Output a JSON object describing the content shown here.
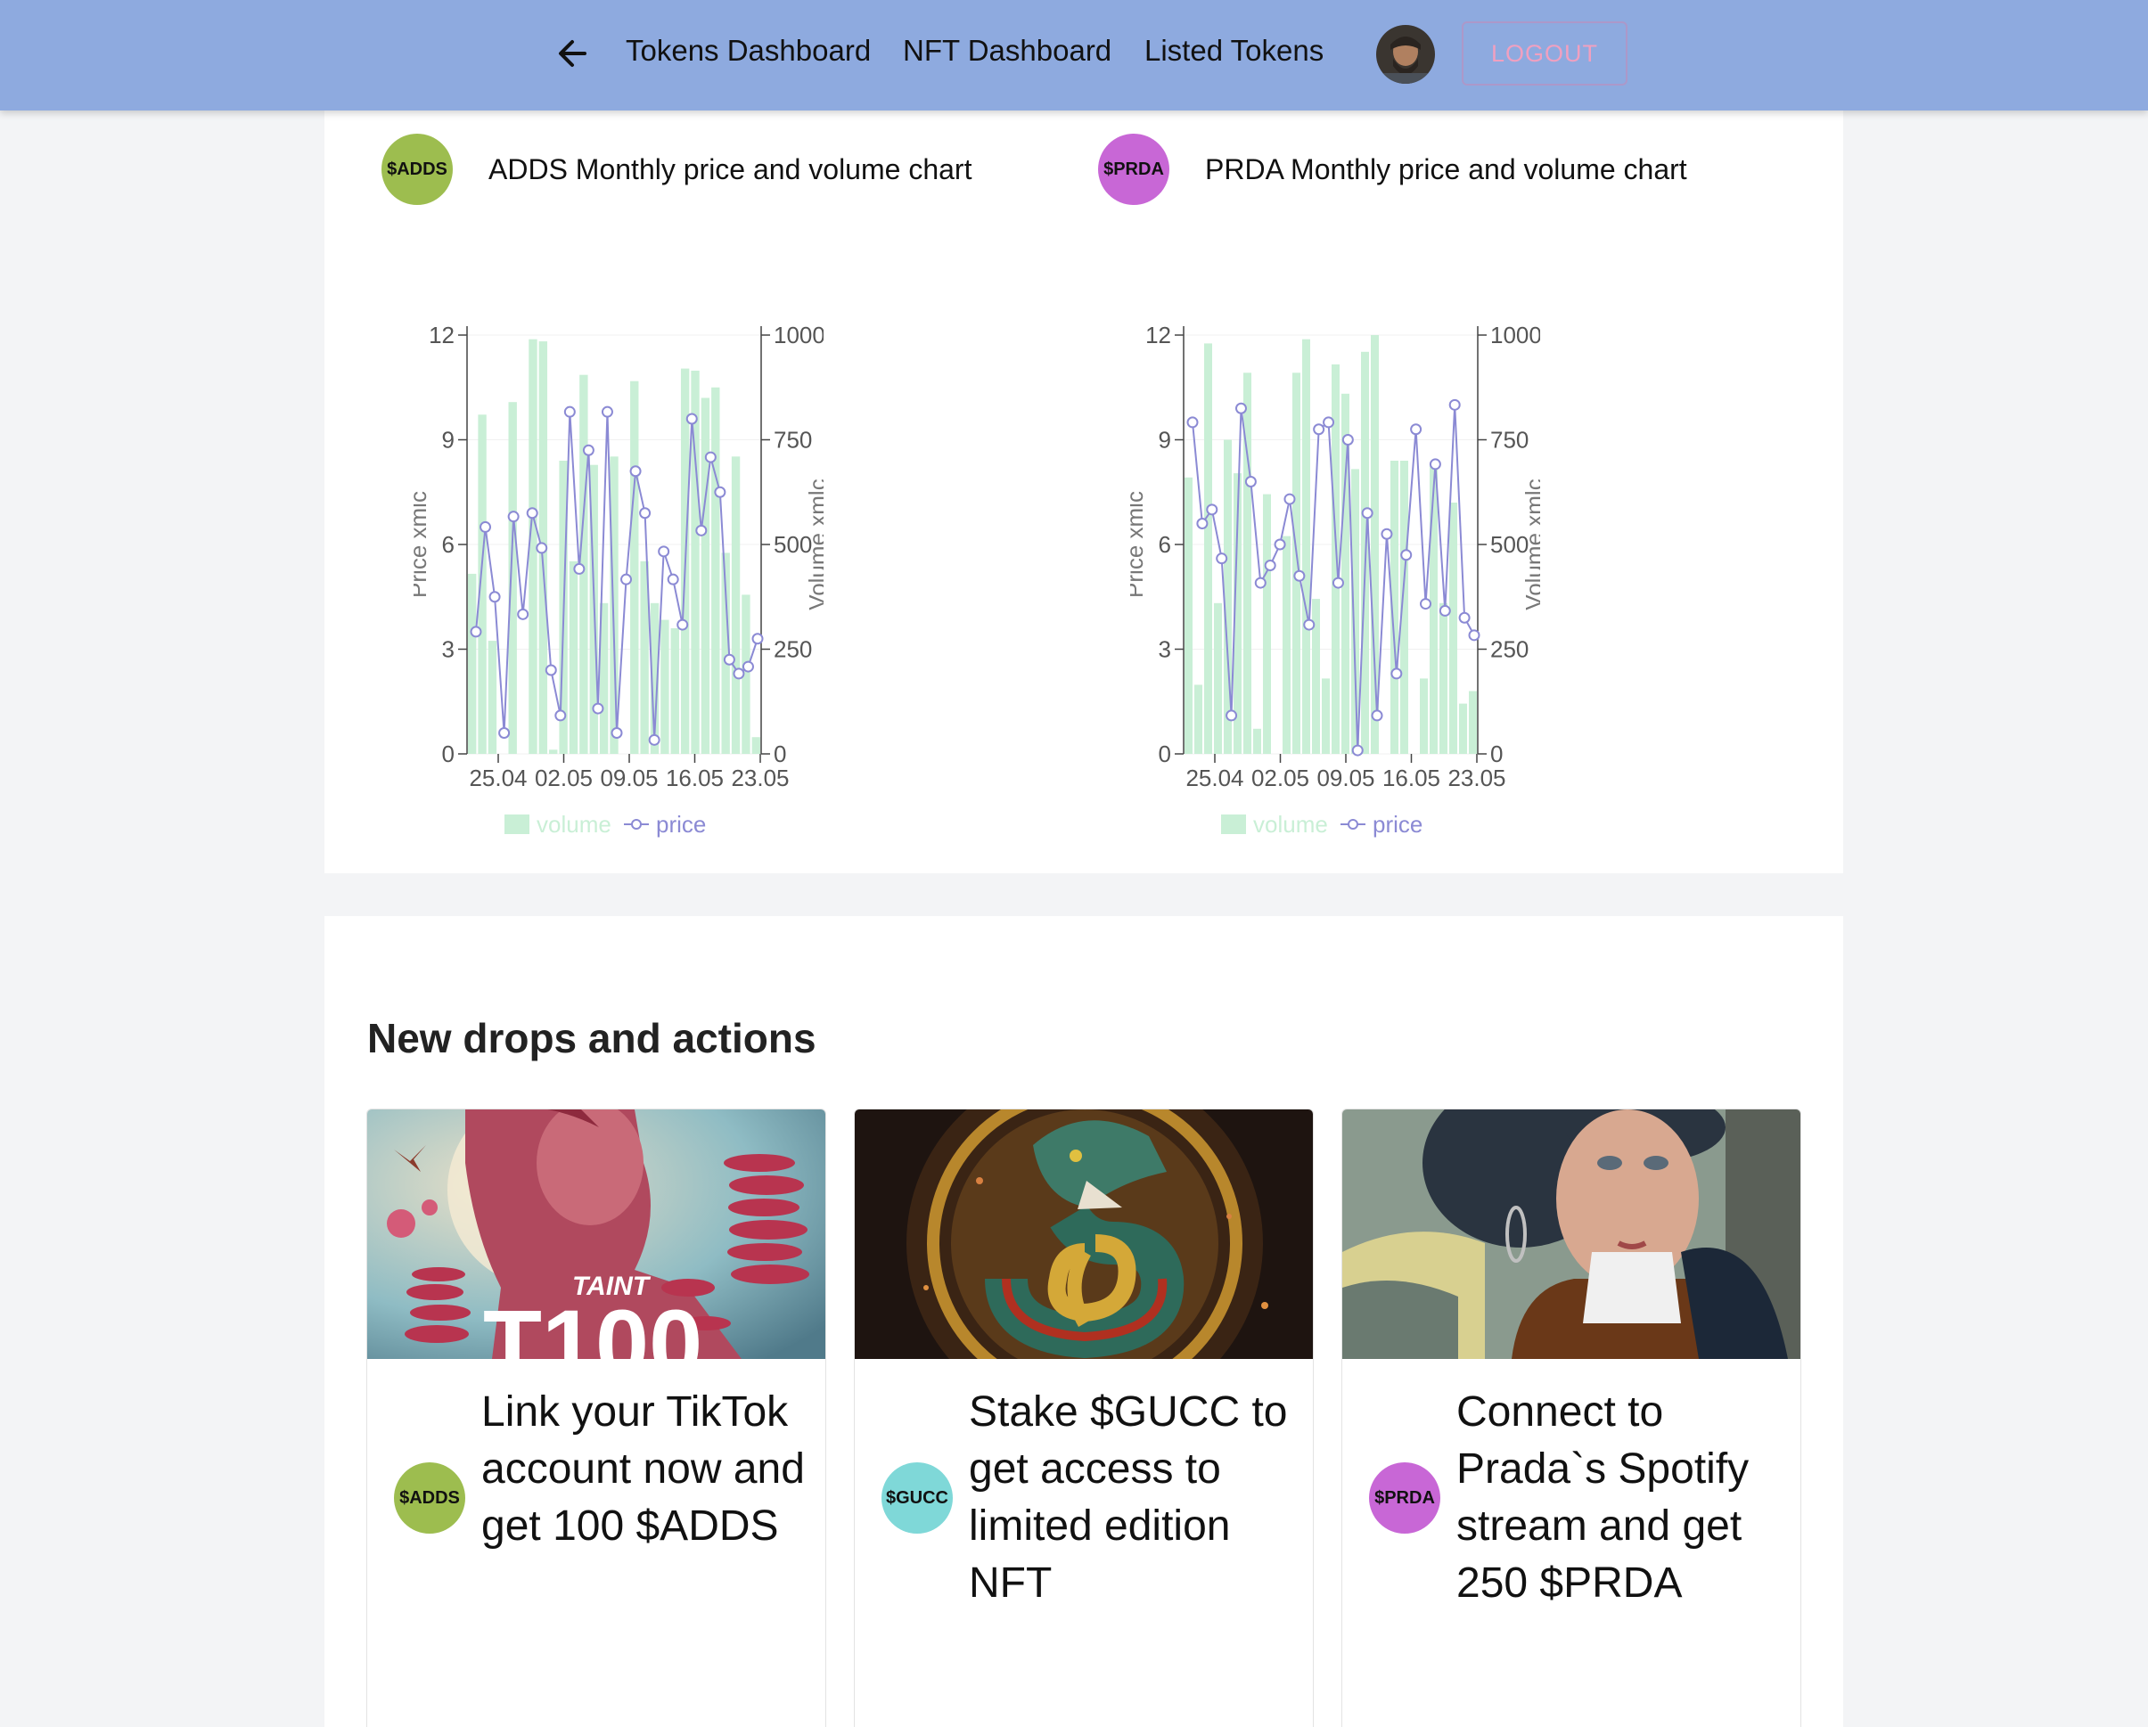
{
  "nav": {
    "links": [
      "Tokens Dashboard",
      "NFT Dashboard",
      "Listed Tokens"
    ],
    "logout_label": "LOGOUT"
  },
  "charts": [
    {
      "token": "$ADDS",
      "token_color": "#9dbd4f",
      "title": "ADDS Monthly price and volume chart",
      "chart_data": {
        "type": "bar+line",
        "x_ticks": [
          "25.04",
          "02.05",
          "09.05",
          "16.05",
          "23.05"
        ],
        "ylabel_left": "Price xmlc",
        "ylabel_right": "Volume xmlc",
        "ylim_left": [
          0,
          12
        ],
        "ylim_right": [
          0,
          1000
        ],
        "y_ticks_left": [
          "0",
          "3",
          "6",
          "9",
          "12"
        ],
        "y_ticks_right": [
          "0",
          "250",
          "500",
          "750",
          "1000"
        ],
        "legend": [
          "volume",
          "price"
        ],
        "volume": [
          430,
          810,
          270,
          0,
          840,
          0,
          990,
          985,
          10,
          700,
          460,
          905,
          690,
          360,
          710,
          0,
          890,
          460,
          360,
          320,
          300,
          920,
          915,
          850,
          875,
          480,
          710,
          380,
          40
        ],
        "price": [
          3.5,
          6.5,
          4.5,
          0.6,
          6.8,
          4.0,
          6.9,
          5.9,
          2.4,
          1.1,
          9.8,
          5.3,
          8.7,
          1.3,
          9.8,
          0.6,
          5.0,
          8.1,
          6.9,
          0.4,
          5.8,
          5.0,
          3.7,
          9.6,
          6.4,
          8.5,
          7.5,
          2.7,
          2.3,
          2.5,
          3.3
        ],
        "series_colors": {
          "volume": "#c9efd6",
          "price": "#8b8ad4"
        }
      }
    },
    {
      "token": "$PRDA",
      "token_color": "#c867d6",
      "title": "PRDA Monthly price and volume chart",
      "chart_data": {
        "type": "bar+line",
        "x_ticks": [
          "25.04",
          "02.05",
          "09.05",
          "16.05",
          "23.05"
        ],
        "ylabel_left": "Price xmlc",
        "ylabel_right": "Volume xmlc",
        "ylim_left": [
          0,
          12
        ],
        "ylim_right": [
          0,
          1000
        ],
        "y_ticks_left": [
          "0",
          "3",
          "6",
          "9",
          "12"
        ],
        "y_ticks_right": [
          "0",
          "250",
          "500",
          "750",
          "1000"
        ],
        "legend": [
          "volume",
          "price"
        ],
        "volume": [
          660,
          165,
          980,
          360,
          750,
          670,
          910,
          60,
          620,
          0,
          520,
          910,
          990,
          370,
          180,
          930,
          860,
          680,
          960,
          1000,
          0,
          700,
          700,
          0,
          180,
          690,
          360,
          600,
          120,
          150
        ],
        "price": [
          9.5,
          6.6,
          7.0,
          5.6,
          1.1,
          9.9,
          7.8,
          4.9,
          5.4,
          6.0,
          7.3,
          5.1,
          3.7,
          9.3,
          9.5,
          4.9,
          9.0,
          0.1,
          6.9,
          1.1,
          6.3,
          2.3,
          5.7,
          9.3,
          4.3,
          8.3,
          4.1,
          10.0,
          3.9,
          3.4
        ]
      }
    }
  ],
  "drops": {
    "section_title": "New drops and actions",
    "cards": [
      {
        "token": "$ADDS",
        "token_color": "#9dbd4f",
        "text": "Link your TikTok account now and get 100 $ADDS",
        "image_caption_top": "TAINT",
        "image_caption_big": "T100"
      },
      {
        "token": "$GUCC",
        "token_color": "#7fd8d8",
        "text": "Stake $GUCC to get access to limited edition NFT"
      },
      {
        "token": "$PRDA",
        "token_color": "#c867d6",
        "text": "Connect to Prada`s Spotify stream and get 250 $PRDA"
      }
    ]
  }
}
